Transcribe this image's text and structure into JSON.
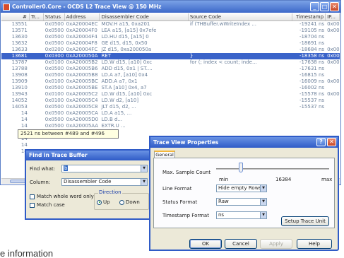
{
  "window": {
    "title": "Controller0.Core - OCDS L2 Trace View @ 150 MHz"
  },
  "columns": [
    "#",
    "Tr...",
    "Status",
    "Address",
    "Disassembler Code",
    "Source Code",
    "Timestamp",
    "IP..."
  ],
  "rows": [
    [
      "13551",
      "",
      "0x0500",
      "0xA20004EC",
      "MOV.H a15, 0xa201",
      "if (THBuffer.wWriteIndex ...",
      "-19241 ns",
      "0x00"
    ],
    [
      "13571",
      "",
      "0x0500",
      "0xA20004F0",
      "LEA a15, [a15] 0x7efe",
      "",
      "-19105 ns",
      "0x00"
    ],
    [
      "13630",
      "",
      "0x0500",
      "0xA20004F4",
      "LD.HU d15, [a15] 0",
      "",
      "-18704 ns",
      ""
    ],
    [
      "13632",
      "",
      "0x0500",
      "0xA20004F8",
      "GE d15, d15, 0x50",
      "",
      "-18691 ns",
      ""
    ],
    [
      "13633",
      "",
      "0x0200",
      "0xA20004FC",
      "JZ d15, 0xa200050a",
      "",
      "-18684 ns",
      "0x00"
    ],
    [
      "13681",
      "",
      "0x0300",
      "0xA200050A",
      "RET",
      "}",
      "-18358 ns",
      "0x00"
    ],
    [
      "13787",
      "",
      "0x0100",
      "0xA20005B2",
      "LD.W d15, [a10] 0xc",
      "for (; index < count; inde...",
      "-17638 ns",
      "0x00"
    ],
    [
      "13788",
      "",
      "0x0500",
      "0xA20005B6",
      "ADD d15, 0x1 | ST....",
      "",
      "-17631 ns",
      ""
    ],
    [
      "13908",
      "",
      "0x0500",
      "0xA20005B8",
      "LD.A a7, [a10] 0x4",
      "",
      "-16815 ns",
      ""
    ],
    [
      "13909",
      "",
      "0x0100",
      "0xA20005BC",
      "ADD.A a7, 0x1",
      "",
      "-16009 ns",
      "0x00"
    ],
    [
      "13910",
      "",
      "0x0500",
      "0xA20005BE",
      "ST.A [a10] 0x4, a7",
      "",
      "-16002 ns",
      ""
    ],
    [
      "13943",
      "",
      "0x0100",
      "0xA20005C2",
      "LD.W d15, [a10] 0xc",
      "",
      "-15578 ns",
      "0x00"
    ],
    [
      "14052",
      "",
      "0x0100",
      "0xA20005C4",
      "LD.W d2, [a10]",
      "",
      "-15537 ns",
      ""
    ],
    [
      "14053",
      "",
      "0x0500",
      "0xA20005C8",
      "JLT d15, d2, ...",
      "",
      "-15537 ns",
      ""
    ],
    [
      "14",
      "",
      "0x0500",
      "0xA20005CA",
      "LD.A a15, ...",
      "",
      "",
      ""
    ],
    [
      "14",
      "",
      "0x0500",
      "0xA20005D0",
      "LD.B d...",
      "",
      "",
      ""
    ],
    [
      "14",
      "",
      "0x0500",
      "0xA20005AA",
      "EXTR.U ...",
      "",
      "",
      ""
    ],
    [
      "14",
      "",
      "",
      "",
      "",
      "",
      "",
      ""
    ],
    [
      "14",
      "",
      "",
      "",
      "",
      "",
      "",
      ""
    ],
    [
      "14",
      "",
      "",
      "",
      "",
      "",
      "",
      ""
    ],
    [
      "14",
      "",
      "",
      "",
      "",
      "",
      "",
      ""
    ]
  ],
  "selected_row_index": 5,
  "tooltip": "2521 ns between #489 and #496",
  "find_dialog": {
    "title": "Find in Trace Buffer",
    "find_what_label": "Find what:",
    "find_what_value": "b",
    "column_label": "Column:",
    "column_value": "Disassembler Code",
    "match_whole_word": "Match whole word only",
    "match_case": "Match case",
    "direction_label": "Direction",
    "direction_up": "Up",
    "direction_down": "Down"
  },
  "props_dialog": {
    "title": "Trace View Properties",
    "help_glyph": "?",
    "close_glyph": "✕",
    "tab_general": "General",
    "max_sample_label": "Max. Sample Count",
    "slider_min": "min",
    "slider_value": "16384",
    "slider_max": "max",
    "slider_fraction": 0.22,
    "line_format_label": "Line Format",
    "line_format_value": "Hide empty Rows",
    "status_format_label": "Status Format",
    "status_format_value": "Raw",
    "timestamp_format_label": "Timestamp Format",
    "timestamp_format_value": "ns",
    "setup_button": "Setup Trace Unit",
    "ok_button": "OK",
    "cancel_button": "Cancel",
    "apply_button": "Apply",
    "help_button": "Help"
  },
  "footer_text": "e information"
}
